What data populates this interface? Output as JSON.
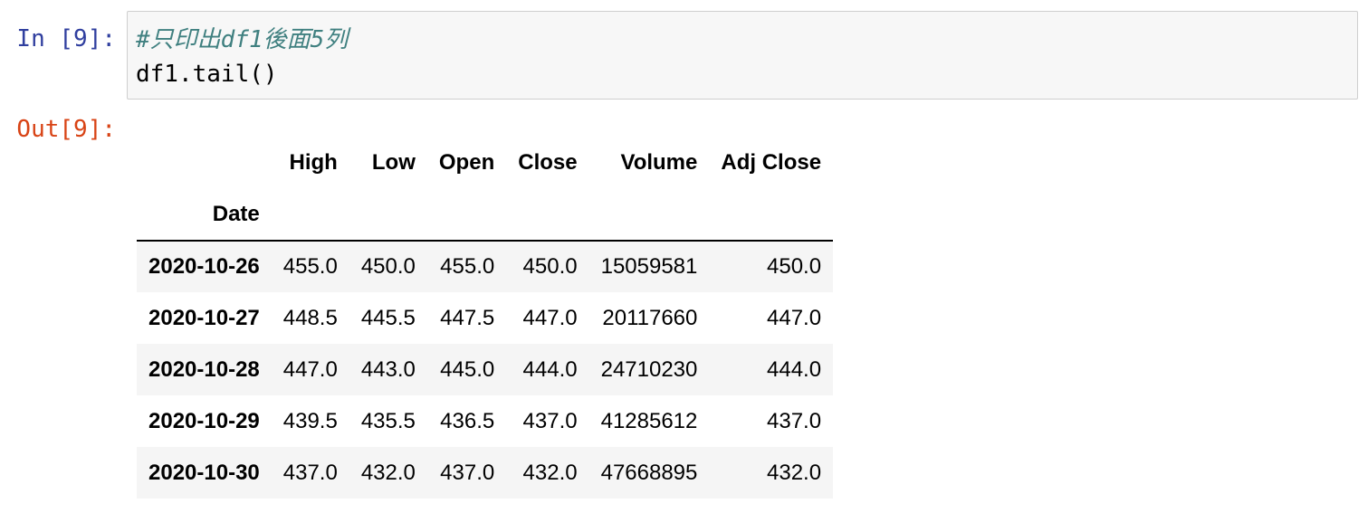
{
  "cell": {
    "in_prompt": "In [9]:",
    "out_prompt": "Out[9]:",
    "code_comment": "#只印出df1後面5列",
    "code_line": "df1.tail()"
  },
  "table": {
    "index_name": "Date",
    "columns": [
      "High",
      "Low",
      "Open",
      "Close",
      "Volume",
      "Adj Close"
    ],
    "rows": [
      {
        "date": "2020-10-26",
        "values": [
          "455.0",
          "450.0",
          "455.0",
          "450.0",
          "15059581",
          "450.0"
        ]
      },
      {
        "date": "2020-10-27",
        "values": [
          "448.5",
          "445.5",
          "447.5",
          "447.0",
          "20117660",
          "447.0"
        ]
      },
      {
        "date": "2020-10-28",
        "values": [
          "447.0",
          "443.0",
          "445.0",
          "444.0",
          "24710230",
          "444.0"
        ]
      },
      {
        "date": "2020-10-29",
        "values": [
          "439.5",
          "435.5",
          "436.5",
          "437.0",
          "41285612",
          "437.0"
        ]
      },
      {
        "date": "2020-10-30",
        "values": [
          "437.0",
          "432.0",
          "437.0",
          "432.0",
          "47668895",
          "432.0"
        ]
      }
    ]
  },
  "colors": {
    "in_prompt": "#303f9f",
    "out_prompt": "#d84315",
    "comment": "#408080",
    "row_stripe": "#f5f5f5"
  }
}
